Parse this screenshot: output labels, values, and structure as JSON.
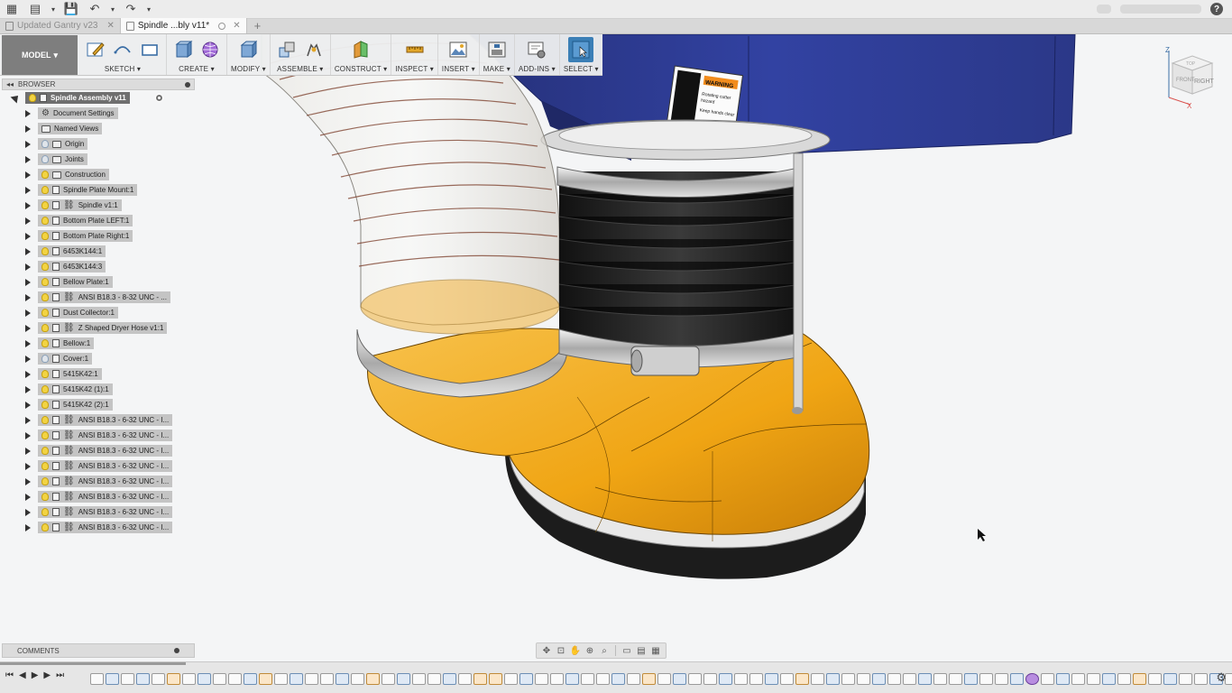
{
  "tabs": [
    {
      "title": "Updated Gantry v23",
      "active": false
    },
    {
      "title": "Spindle ...bly v11*",
      "active": true
    }
  ],
  "toolbar": {
    "mode": "MODEL",
    "groups": [
      {
        "label": "SKETCH"
      },
      {
        "label": "CREATE"
      },
      {
        "label": "MODIFY"
      },
      {
        "label": "ASSEMBLE"
      },
      {
        "label": "CONSTRUCT"
      },
      {
        "label": "INSPECT"
      },
      {
        "label": "INSERT"
      },
      {
        "label": "MAKE"
      },
      {
        "label": "ADD-INS"
      },
      {
        "label": "SELECT"
      }
    ]
  },
  "browser": {
    "title": "BROWSER",
    "root": "Spindle Assembly v11",
    "items": [
      {
        "label": "Document Settings",
        "icon": "gear-icon",
        "bulb": false
      },
      {
        "label": "Named Views",
        "icon": "folder-icon",
        "bulb": false
      },
      {
        "label": "Origin",
        "icon": "folder-icon",
        "bulb": "off"
      },
      {
        "label": "Joints",
        "icon": "folder-icon",
        "bulb": "off"
      },
      {
        "label": "Construction",
        "icon": "folder-icon",
        "bulb": "on"
      },
      {
        "label": "Spindle Plate Mount:1",
        "icon": "component-icon",
        "bulb": "on"
      },
      {
        "label": "Spindle v1:1",
        "icon": "link-icon",
        "bulb": "on"
      },
      {
        "label": "Bottom Plate LEFT:1",
        "icon": "component-icon",
        "bulb": "on"
      },
      {
        "label": "Bottom Plate Right:1",
        "icon": "component-icon",
        "bulb": "on"
      },
      {
        "label": "6453K144:1",
        "icon": "component-icon",
        "bulb": "on"
      },
      {
        "label": "6453K144:3",
        "icon": "component-icon",
        "bulb": "on"
      },
      {
        "label": "Bellow Plate:1",
        "icon": "component-icon",
        "bulb": "on"
      },
      {
        "label": "ANSI B18.3 - 8-32 UNC - ...",
        "icon": "link-icon",
        "bulb": "on"
      },
      {
        "label": "Dust Collector:1",
        "icon": "component-icon",
        "bulb": "on"
      },
      {
        "label": "Z Shaped Dryer Hose v1:1",
        "icon": "link-icon",
        "bulb": "on"
      },
      {
        "label": "Bellow:1",
        "icon": "component-icon",
        "bulb": "on"
      },
      {
        "label": "Cover:1",
        "icon": "component-icon",
        "bulb": "off"
      },
      {
        "label": "5415K42:1",
        "icon": "component-icon",
        "bulb": "on"
      },
      {
        "label": "5415K42 (1):1",
        "icon": "component-icon",
        "bulb": "on"
      },
      {
        "label": "5415K42 (2):1",
        "icon": "component-icon",
        "bulb": "on"
      },
      {
        "label": "ANSI B18.3 - 6-32 UNC - I...",
        "icon": "link-icon",
        "bulb": "on"
      },
      {
        "label": "ANSI B18.3 - 6-32 UNC - I...",
        "icon": "link-icon",
        "bulb": "on"
      },
      {
        "label": "ANSI B18.3 - 6-32 UNC - I...",
        "icon": "link-icon",
        "bulb": "on"
      },
      {
        "label": "ANSI B18.3 - 6-32 UNC - I...",
        "icon": "link-icon",
        "bulb": "on"
      },
      {
        "label": "ANSI B18.3 - 6-32 UNC - I...",
        "icon": "link-icon",
        "bulb": "on"
      },
      {
        "label": "ANSI B18.3 - 6-32 UNC - I...",
        "icon": "link-icon",
        "bulb": "on"
      },
      {
        "label": "ANSI B18.3 - 6-32 UNC - I...",
        "icon": "link-icon",
        "bulb": "on"
      },
      {
        "label": "ANSI B18.3 - 6-32 UNC - I...",
        "icon": "link-icon",
        "bulb": "on"
      }
    ]
  },
  "viewcube": {
    "top": "TOP",
    "right": "RIGHT",
    "front": "FRONT",
    "z": "Z",
    "x": "X"
  },
  "warning_label": {
    "title": "WARNING",
    "line1": "Rotating cutter",
    "line2": "hazard",
    "line3": "Keep hands clear"
  },
  "comments": {
    "title": "COMMENTS"
  },
  "colors": {
    "housing": "#2f3d8f",
    "duct": "#f2a91c",
    "brush": "#2a2a2a",
    "selected": "#3b7fb6"
  }
}
